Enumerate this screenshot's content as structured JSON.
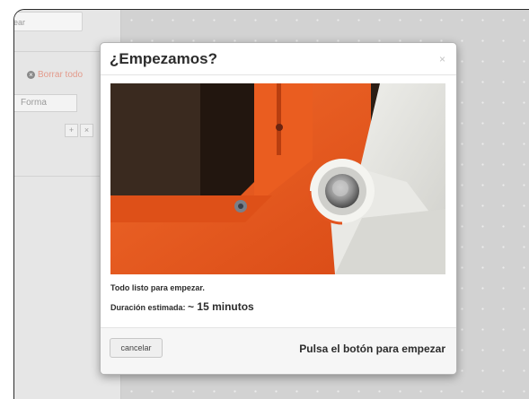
{
  "left_panel": {
    "search_input_value": "ear",
    "clear_all_label": "Borrar todo",
    "shape_label": "Forma",
    "tool_add_glyph": "+",
    "tool_remove_glyph": "×"
  },
  "modal": {
    "title": "¿Empezamos?",
    "close_glyph": "×",
    "photo_icon": "machine-start-button-photo",
    "ready_text": "Todo listo para empezar.",
    "duration_label": "Duración estimada:",
    "duration_value": "~ 15 minutos",
    "cancel_label": "cancelar",
    "start_hint": "Pulsa el botón para empezar"
  },
  "colors": {
    "accent_orange": "#e2541f",
    "clear_link": "#e39a8b",
    "canvas_bg": "#d2d2d2"
  }
}
